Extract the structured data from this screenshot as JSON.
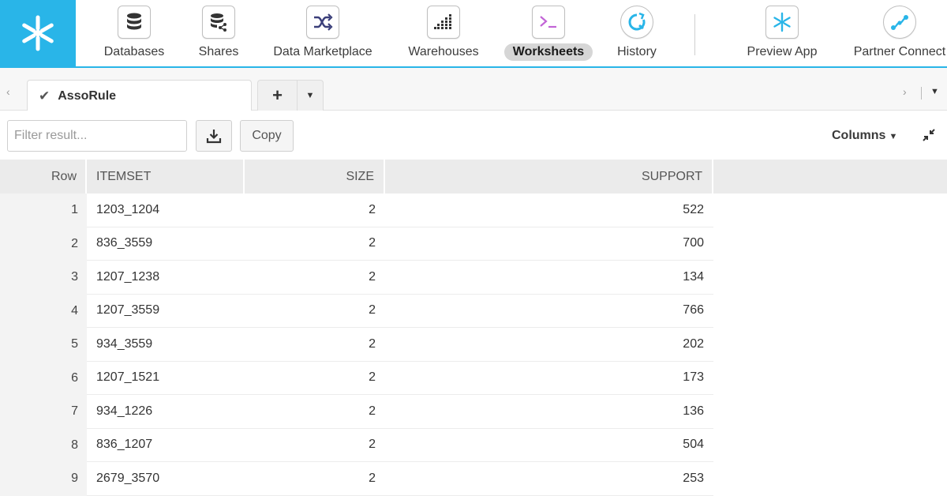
{
  "nav": {
    "items": [
      {
        "label": "Databases",
        "icon": "database-icon"
      },
      {
        "label": "Shares",
        "icon": "shared-database-icon"
      },
      {
        "label": "Data Marketplace",
        "icon": "shuffle-icon"
      },
      {
        "label": "Warehouses",
        "icon": "warehouse-grid-icon"
      },
      {
        "label": "Worksheets",
        "icon": "terminal-icon",
        "active": true
      },
      {
        "label": "History",
        "icon": "history-refresh-icon"
      },
      {
        "label": "Preview App",
        "icon": "snowflake-icon"
      },
      {
        "label": "Partner Connect",
        "icon": "connect-nodes-icon"
      }
    ]
  },
  "tabs": {
    "active_label": "AssoRule",
    "add_symbol": "+"
  },
  "toolbar": {
    "filter_placeholder": "Filter result...",
    "copy_label": "Copy",
    "columns_label": "Columns"
  },
  "table": {
    "headers": {
      "row": "Row",
      "itemset": "ITEMSET",
      "size": "SIZE",
      "support": "SUPPORT"
    },
    "rows": [
      {
        "row": "1",
        "itemset": "1203_1204",
        "size": "2",
        "support": "522"
      },
      {
        "row": "2",
        "itemset": "836_3559",
        "size": "2",
        "support": "700"
      },
      {
        "row": "3",
        "itemset": "1207_1238",
        "size": "2",
        "support": "134"
      },
      {
        "row": "4",
        "itemset": "1207_3559",
        "size": "2",
        "support": "766"
      },
      {
        "row": "5",
        "itemset": "934_3559",
        "size": "2",
        "support": "202"
      },
      {
        "row": "6",
        "itemset": "1207_1521",
        "size": "2",
        "support": "173"
      },
      {
        "row": "7",
        "itemset": "934_1226",
        "size": "2",
        "support": "136"
      },
      {
        "row": "8",
        "itemset": "836_1207",
        "size": "2",
        "support": "504"
      },
      {
        "row": "9",
        "itemset": "2679_3570",
        "size": "2",
        "support": "253"
      }
    ]
  },
  "colors": {
    "brand": "#29b5e8",
    "active_pill": "#d6d6d6"
  }
}
